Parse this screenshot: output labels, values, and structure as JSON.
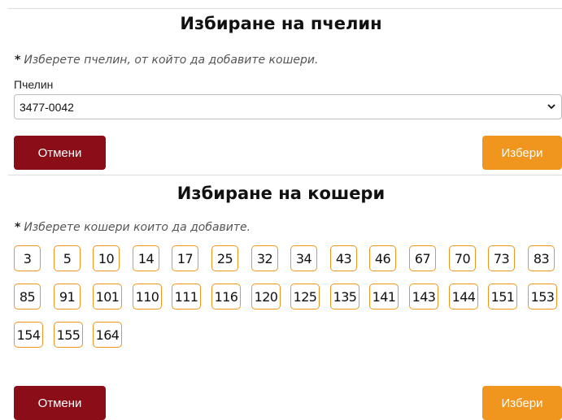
{
  "apiary_section": {
    "title": "Избиране на пчелин",
    "hint_star": "*",
    "hint": "Изберете пчелин, от който да добавите кошери.",
    "field_label": "Пчелин",
    "selected_apiary": "3477-0042",
    "cancel_label": "Отмени",
    "choose_label": "Избери"
  },
  "hives_section": {
    "title": "Избиране на кошери",
    "hint_star": "*",
    "hint": "Изберете кошери които да добавите.",
    "hives": [
      "3",
      "5",
      "10",
      "14",
      "17",
      "25",
      "32",
      "34",
      "43",
      "46",
      "67",
      "70",
      "73",
      "83",
      "85",
      "91",
      "101",
      "110",
      "111",
      "116",
      "120",
      "125",
      "135",
      "141",
      "143",
      "144",
      "151",
      "153",
      "154",
      "155",
      "164"
    ],
    "cancel_label": "Отмени",
    "choose_label": "Избери"
  },
  "colors": {
    "cancel": "#8b0d17",
    "accent": "#f0961e"
  }
}
